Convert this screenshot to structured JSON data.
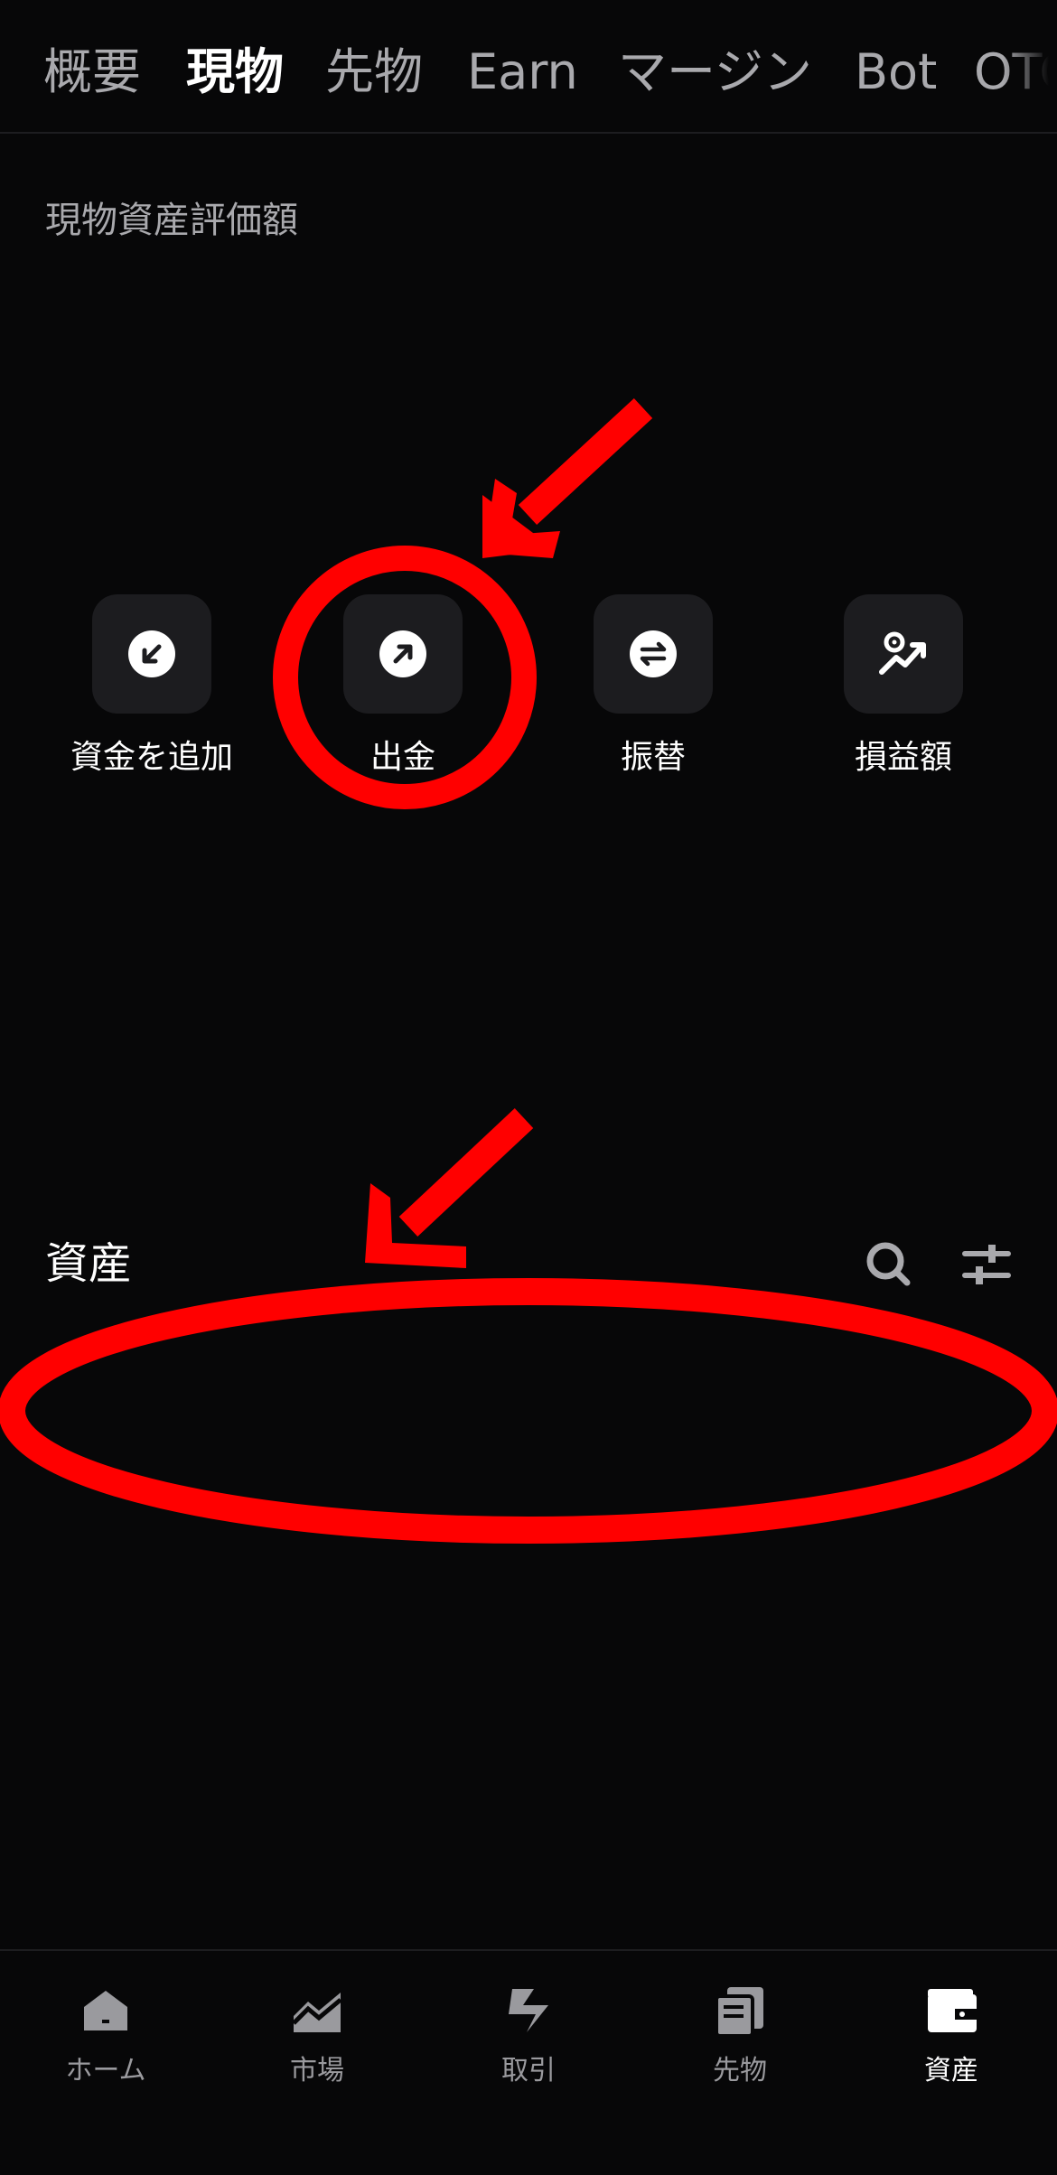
{
  "tabs": [
    {
      "label": "概要",
      "active": false
    },
    {
      "label": "現物",
      "active": true
    },
    {
      "label": "先物",
      "active": false
    },
    {
      "label": "Earn",
      "active": false
    },
    {
      "label": "マージン",
      "active": false
    },
    {
      "label": "Bot",
      "active": false
    },
    {
      "label": "OTC",
      "active": false
    }
  ],
  "spot": {
    "valuation_label": "現物資産評価額"
  },
  "actions": [
    {
      "label": "資金を追加",
      "icon": "deposit-arrow-icon"
    },
    {
      "label": "出金",
      "icon": "withdraw-arrow-icon"
    },
    {
      "label": "振替",
      "icon": "transfer-arrows-icon"
    },
    {
      "label": "損益額",
      "icon": "pnl-chart-icon"
    }
  ],
  "assets": {
    "title": "資産",
    "search_icon": "search-icon",
    "filter_icon": "filter-sliders-icon"
  },
  "annotations": {
    "color": "#ff0000"
  },
  "bottom_nav": [
    {
      "label": "ホーム",
      "icon": "home-icon",
      "active": false
    },
    {
      "label": "市場",
      "icon": "market-chart-icon",
      "active": false
    },
    {
      "label": "取引",
      "icon": "trade-icon",
      "active": false
    },
    {
      "label": "先物",
      "icon": "futures-doc-icon",
      "active": false
    },
    {
      "label": "資産",
      "icon": "wallet-icon",
      "active": true
    }
  ],
  "colors": {
    "background": "#070708",
    "button_bg": "#1c1c1f",
    "text_primary": "#ffffff",
    "text_secondary": "#a9a9ad"
  }
}
